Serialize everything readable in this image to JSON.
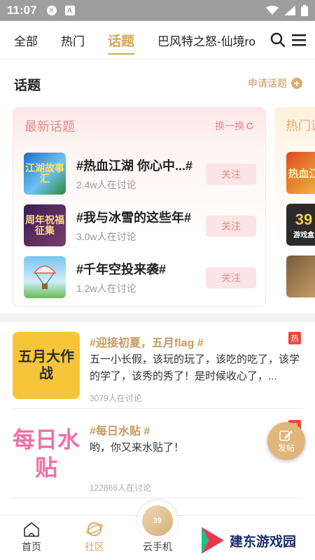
{
  "status_bar": {
    "time": "11:07",
    "icons": [
      "x-circle-icon",
      "a-box-icon",
      "wifi-icon",
      "signal-icon",
      "battery-icon"
    ]
  },
  "top_nav": {
    "tabs": [
      {
        "label": "全部"
      },
      {
        "label": "热门"
      },
      {
        "label": "话题",
        "active": true
      },
      {
        "label": "巴风特之怒-仙境ro"
      }
    ],
    "icons": [
      "search-icon",
      "menu-icon"
    ]
  },
  "topics": {
    "title": "话题",
    "apply_label": "申请话题",
    "latest": {
      "title": "最新话题",
      "refresh_label": "换一换",
      "items": [
        {
          "name": "#热血江湖 你心中...#",
          "count": "2.4w人在讨论",
          "follow": "关注",
          "thumb_text": "江湖故事汇"
        },
        {
          "name": "#我与冰雪的这些年#",
          "count": "3.0w人在讨论",
          "follow": "关注",
          "thumb_text": "周年祝福征集"
        },
        {
          "name": "#千年空投来袭#",
          "count": "1.2w人在讨论",
          "follow": "关注",
          "thumb_text": ""
        }
      ]
    },
    "hot": {
      "title": "热门话",
      "thumbs": [
        "热血江",
        "39",
        ""
      ],
      "thumb_caption": "游戏盒"
    }
  },
  "posts": [
    {
      "tag": "#迎接初夏，五月flag #",
      "body": "五一小长假，该玩的玩了，该吃的吃了，该学的学了，该秀的秀了！是时候收心了，...",
      "meta": "3079人在讨论",
      "badge": "热",
      "thumb_text": "五月大作战"
    },
    {
      "tag": "#每日水贴 #",
      "body": "哟，你又来水贴了！",
      "meta": "122866人在讨论",
      "badge": "热",
      "thumb_text": "每日水贴"
    }
  ],
  "fab": {
    "label": "发帖"
  },
  "bottom_nav": {
    "items": [
      {
        "label": "首页"
      },
      {
        "label": "社区",
        "active": true
      },
      {
        "label": "云手机"
      }
    ],
    "center_badge": "39"
  },
  "watermark": {
    "text": "建东游戏园"
  },
  "colors": {
    "accent": "#d9a35b",
    "latest_title": "#e58a8a",
    "hot_badge": "#ea4a3a"
  }
}
